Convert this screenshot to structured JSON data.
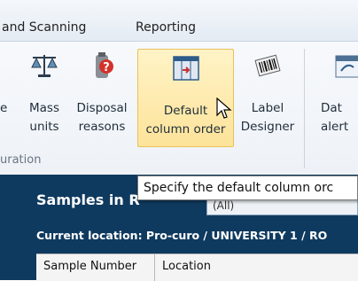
{
  "menu": {
    "items": [
      {
        "label": "and Scanning"
      },
      {
        "label": "Reporting"
      }
    ]
  },
  "ribbon": {
    "buttons": [
      {
        "line1": "e",
        "line2": "",
        "icon": "partial-button-icon"
      },
      {
        "line1": "Mass",
        "line2": "units",
        "icon": "scales-icon"
      },
      {
        "line1": "Disposal",
        "line2": "reasons",
        "icon": "disposal-bottle-icon"
      },
      {
        "line1": "Default",
        "line2": "column order",
        "icon": "column-order-icon"
      },
      {
        "line1": "Label",
        "line2": "Designer",
        "icon": "barcode-icon"
      },
      {
        "line1": "Dat",
        "line2": "alert",
        "icon": "calendar-alert-icon"
      }
    ],
    "group_label": "uration"
  },
  "tooltip": {
    "text": "Specify the default column orc"
  },
  "panel": {
    "title": "Samples in R",
    "combo_value": "(All)",
    "location": "Current location: Pro-curo / UNIVERSITY 1 / RO",
    "columns": [
      "Sample Number",
      "Location"
    ]
  },
  "colors": {
    "accent_hover": "#fde39a",
    "panel_bg": "#0f3a5f",
    "ribbon_bg": "#eef2f7"
  }
}
